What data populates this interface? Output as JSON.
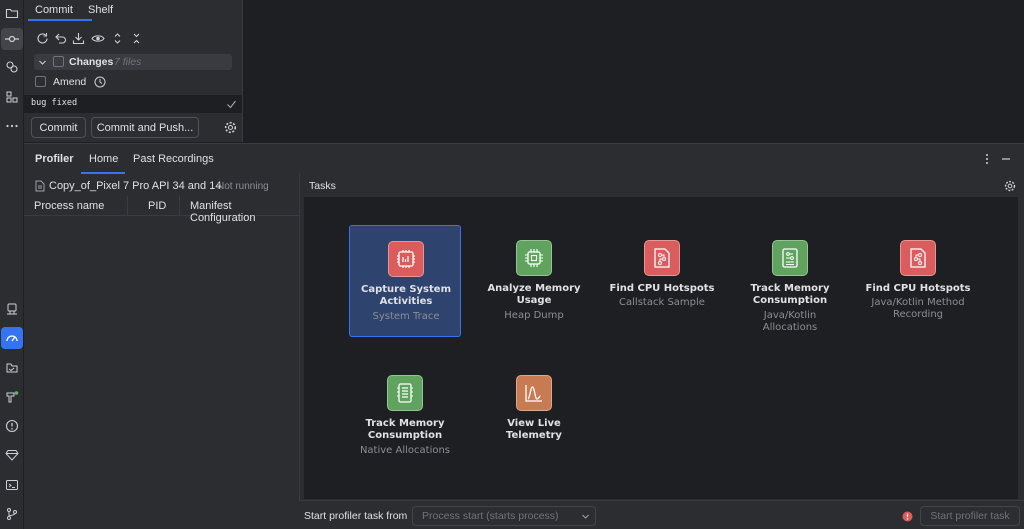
{
  "commit": {
    "tabs": [
      "Commit",
      "Shelf"
    ],
    "changes_label": "Changes",
    "changes_count": "7 files",
    "amend_label": "Amend",
    "message": "bug fixed",
    "commit_button": "Commit",
    "commit_push_button": "Commit and Push..."
  },
  "profiler": {
    "title": "Profiler",
    "tabs": [
      "Home",
      "Past Recordings"
    ],
    "device": "Copy_of_Pixel 7 Pro API 34 and 14",
    "device_status": "Not running",
    "columns": [
      "Process name",
      "PID",
      "Manifest Configuration"
    ],
    "tasks_label": "Tasks",
    "tasks": [
      {
        "title1": "Capture System",
        "title2": "Activities",
        "sub1": "System Trace",
        "sub2": "",
        "color": "#db5c5c",
        "icon": "cpu-trace-icon",
        "selected": true
      },
      {
        "title1": "Analyze Memory",
        "title2": "Usage",
        "sub1": "Heap Dump",
        "sub2": "",
        "color": "#5fa35f",
        "icon": "memory-chip-icon",
        "selected": false
      },
      {
        "title1": "Find CPU Hotspots",
        "title2": "",
        "sub1": "Callstack Sample",
        "sub2": "",
        "color": "#db5c5c",
        "icon": "cpu-hotspot-icon",
        "selected": false
      },
      {
        "title1": "Track Memory",
        "title2": "Consumption",
        "sub1": "Java/Kotlin",
        "sub2": "Allocations",
        "color": "#5fa35f",
        "icon": "memory-track-icon",
        "selected": false
      },
      {
        "title1": "Find CPU Hotspots",
        "title2": "",
        "sub1": "Java/Kotlin Method",
        "sub2": "Recording",
        "color": "#db5c5c",
        "icon": "cpu-method-icon",
        "selected": false
      },
      {
        "title1": "Track Memory",
        "title2": "Consumption",
        "sub1": "Native Allocations",
        "sub2": "",
        "color": "#5fa35f",
        "icon": "native-memory-icon",
        "selected": false
      },
      {
        "title1": "View Live Telemetry",
        "title2": "",
        "sub1": "",
        "sub2": "",
        "color": "#c87a52",
        "icon": "telemetry-icon",
        "selected": false
      }
    ],
    "start_from_label": "Start profiler task from",
    "start_from_value": "Process start (starts process)",
    "start_button": "Start profiler task"
  }
}
